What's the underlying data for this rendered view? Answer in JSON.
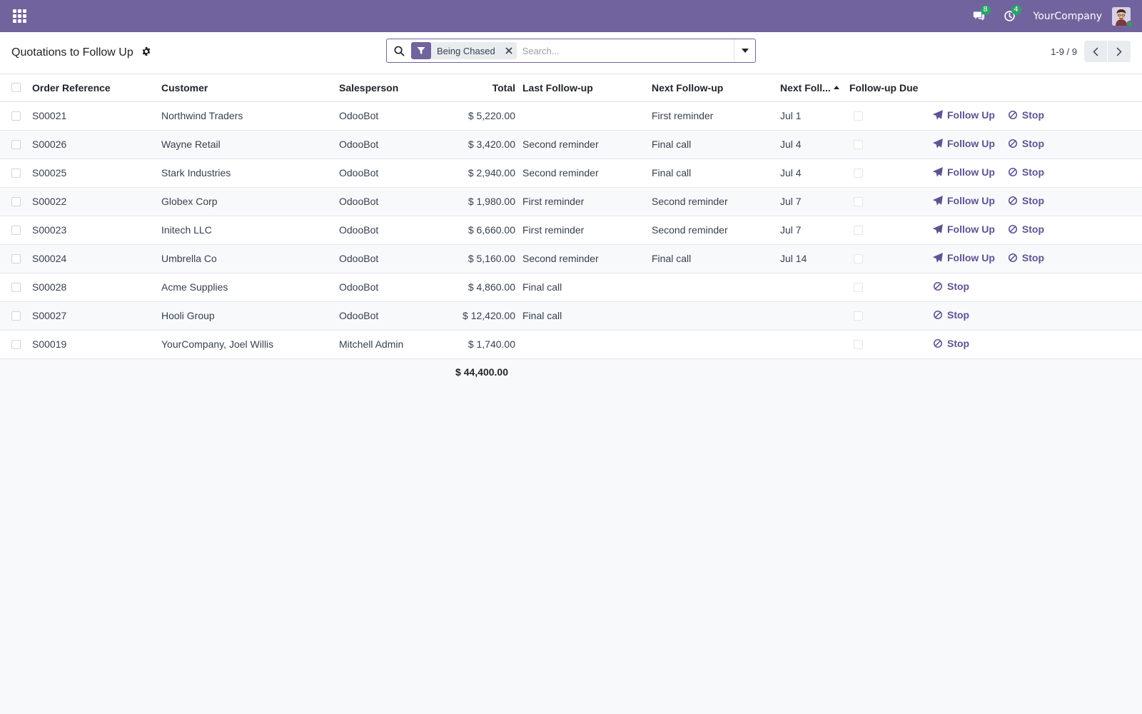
{
  "navbar": {
    "apps_icon": "apps-grid-icon",
    "messages_count": "8",
    "activities_count": "4",
    "company": "YourCompany"
  },
  "control_panel": {
    "title": "Quotations to Follow Up",
    "search": {
      "facet_label": "Being Chased",
      "placeholder": "Search..."
    },
    "pager": {
      "value": "1-9 / 9"
    }
  },
  "table": {
    "headers": {
      "ref": "Order Reference",
      "customer": "Customer",
      "salesperson": "Salesperson",
      "total": "Total",
      "last": "Last Follow-up",
      "next": "Next Follow-up",
      "next_date": "Next Foll...",
      "due": "Follow-up Due"
    },
    "rows": [
      {
        "ref": "S00021",
        "customer": "Northwind Traders",
        "salesperson": "OdooBot",
        "total": "$ 5,220.00",
        "last": "",
        "next": "First reminder",
        "next_date": "Jul 1",
        "follow_up": "Follow Up",
        "stop": "Stop"
      },
      {
        "ref": "S00026",
        "customer": "Wayne Retail",
        "salesperson": "OdooBot",
        "total": "$ 3,420.00",
        "last": "Second reminder",
        "next": "Final call",
        "next_date": "Jul 4",
        "follow_up": "Follow Up",
        "stop": "Stop"
      },
      {
        "ref": "S00025",
        "customer": "Stark Industries",
        "salesperson": "OdooBot",
        "total": "$ 2,940.00",
        "last": "Second reminder",
        "next": "Final call",
        "next_date": "Jul 4",
        "follow_up": "Follow Up",
        "stop": "Stop"
      },
      {
        "ref": "S00022",
        "customer": "Globex Corp",
        "salesperson": "OdooBot",
        "total": "$ 1,980.00",
        "last": "First reminder",
        "next": "Second reminder",
        "next_date": "Jul 7",
        "follow_up": "Follow Up",
        "stop": "Stop"
      },
      {
        "ref": "S00023",
        "customer": "Initech LLC",
        "salesperson": "OdooBot",
        "total": "$ 6,660.00",
        "last": "First reminder",
        "next": "Second reminder",
        "next_date": "Jul 7",
        "follow_up": "Follow Up",
        "stop": "Stop"
      },
      {
        "ref": "S00024",
        "customer": "Umbrella Co",
        "salesperson": "OdooBot",
        "total": "$ 5,160.00",
        "last": "Second reminder",
        "next": "Final call",
        "next_date": "Jul 14",
        "follow_up": "Follow Up",
        "stop": "Stop"
      },
      {
        "ref": "S00028",
        "customer": "Acme Supplies",
        "salesperson": "OdooBot",
        "total": "$ 4,860.00",
        "last": "Final call",
        "next": "",
        "next_date": "",
        "follow_up": "",
        "stop": "Stop"
      },
      {
        "ref": "S00027",
        "customer": "Hooli Group",
        "salesperson": "OdooBot",
        "total": "$ 12,420.00",
        "last": "Final call",
        "next": "",
        "next_date": "",
        "follow_up": "",
        "stop": "Stop"
      },
      {
        "ref": "S00019",
        "customer": "YourCompany, Joel Willis",
        "salesperson": "Mitchell Admin",
        "total": "$ 1,740.00",
        "last": "",
        "next": "",
        "next_date": "",
        "follow_up": "",
        "stop": "Stop"
      }
    ],
    "grand_total": "$ 44,400.00"
  },
  "colors": {
    "brand": "#71639e",
    "action": "#5f5294",
    "badge": "#29a36a"
  }
}
